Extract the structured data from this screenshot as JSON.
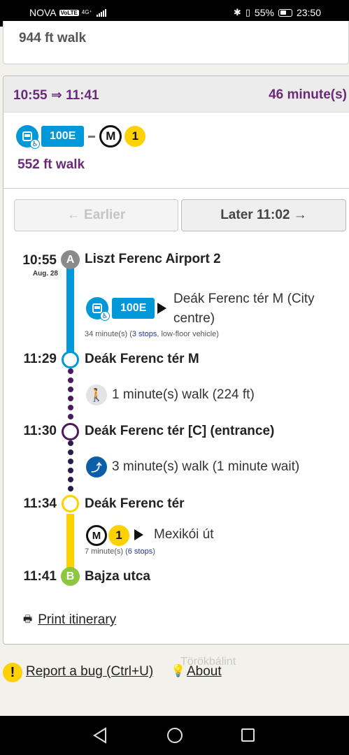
{
  "status_bar": {
    "carrier": "NOVA",
    "volte": "VoLTE",
    "network": "4G⁺",
    "battery": "55%",
    "time": "23:50"
  },
  "previous_option": {
    "walk": "944 ft walk"
  },
  "option": {
    "time_range": "10:55 ⇒ 11:41",
    "duration": "46 minute(s)",
    "route_badge": "100E",
    "metro_symbol": "M",
    "metro_line": "1",
    "walk": "552 ft walk"
  },
  "buttons": {
    "earlier": "← Earlier",
    "later": "Later 11:02 →"
  },
  "itinerary": {
    "stops": [
      {
        "time": "10:55",
        "date": "Aug. 28",
        "name": "Liszt Ferenc Airport 2",
        "marker": "A"
      },
      {
        "time": "11:29",
        "name": "Deák Ferenc tér M"
      },
      {
        "time": "11:30",
        "name": "Deák Ferenc tér [C] (entrance)"
      },
      {
        "time": "11:34",
        "name": "Deák Ferenc tér"
      },
      {
        "time": "11:41",
        "name": "Bajza utca",
        "marker": "B"
      }
    ],
    "legs": [
      {
        "route": "100E",
        "destination": "Deák Ferenc tér M (City centre)",
        "duration": "34 minute(s) (",
        "stops": "3 stops",
        "extra": ", low-floor vehicle)"
      },
      {
        "text": "1 minute(s) walk (224 ft)"
      },
      {
        "text": "3 minute(s) walk (1 minute wait)"
      },
      {
        "metro": "M",
        "line": "1",
        "destination": "Mexikói út",
        "duration": "7 minute(s) (",
        "stops": "6 stops",
        "extra": ")"
      }
    ]
  },
  "print": "Print itinerary",
  "footer": {
    "bug_icon": "!",
    "report_bug": "Report a bug (Ctrl+U)",
    "about": "About"
  },
  "map": {
    "place_label": "Törökbálint"
  },
  "colors": {
    "purple": "#6b2a78",
    "bus_blue": "#0098d8",
    "metro_yellow": "#fed100",
    "walk_dots": "#4a1a5e",
    "end_green": "#8dc63f"
  },
  "icons": [
    "bus-icon",
    "wheelchair-icon",
    "metro-icon",
    "walk-icon",
    "escalator-icon",
    "printer-icon",
    "lightbulb-icon",
    "bluetooth-icon",
    "vibrate-icon",
    "battery-icon"
  ]
}
